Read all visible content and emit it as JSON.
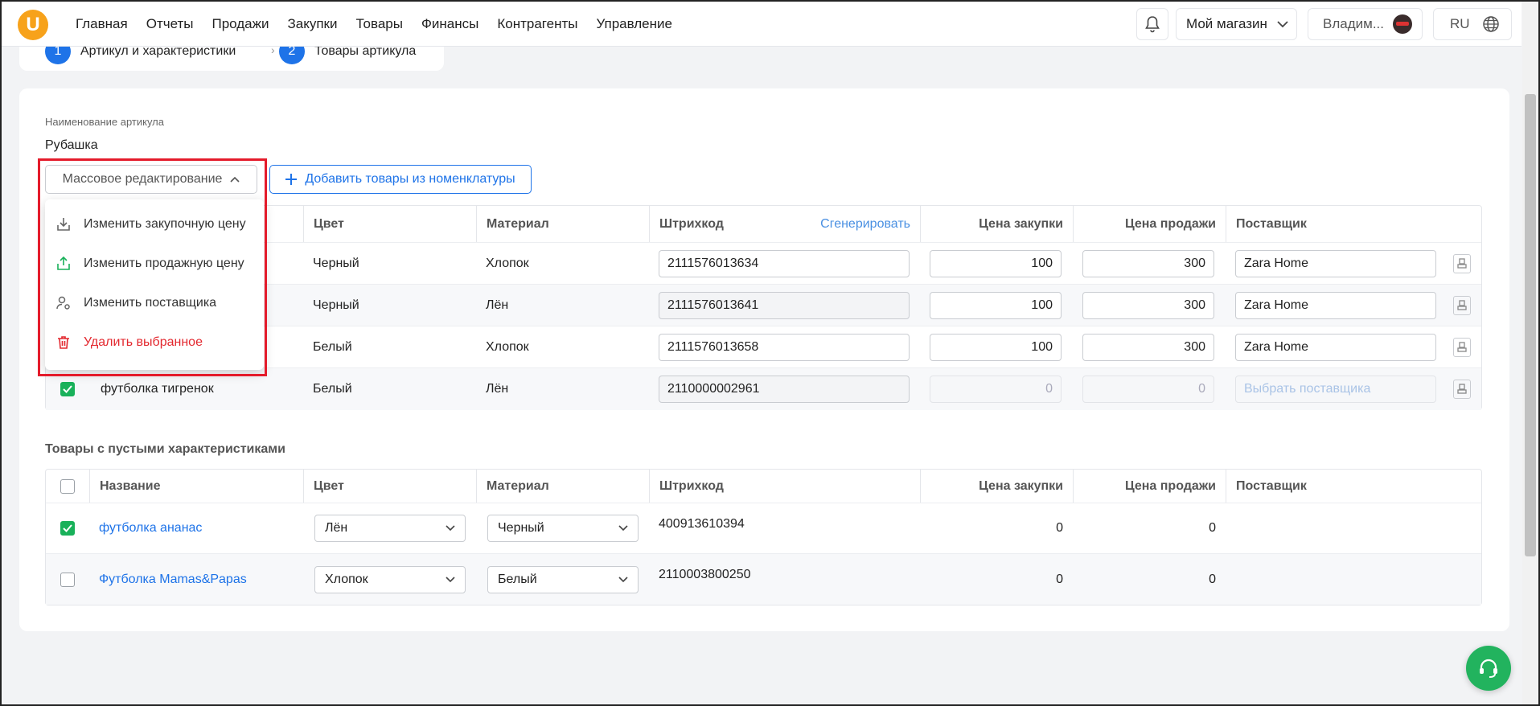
{
  "nav": [
    "Главная",
    "Отчеты",
    "Продажи",
    "Закупки",
    "Товары",
    "Финансы",
    "Контрагенты",
    "Управление"
  ],
  "header": {
    "logo": "U",
    "store": "Мой магазин",
    "user": "Владим...",
    "lang": "RU"
  },
  "stepper": {
    "step1_num": "1",
    "step1": "Артикул и характеристики",
    "step2_num": "2",
    "step2": "Товары артикула"
  },
  "article": {
    "label": "Наименование артикула",
    "name": "Рубашка"
  },
  "toolbar": {
    "mass_edit": "Массовое редактирование",
    "add_items": "Добавить товары из номенклатуры"
  },
  "dropdown": [
    "Изменить закупочную цену",
    "Изменить продажную цену",
    "Изменить поставщика",
    "Удалить выбранное"
  ],
  "table1": {
    "headers": {
      "color": "Цвет",
      "material": "Материал",
      "barcode": "Штрихкод",
      "generate": "Сгенерировать",
      "buy": "Цена закупки",
      "sell": "Цена продажи",
      "supplier": "Поставщик"
    },
    "rows": [
      {
        "name": "",
        "color": "Черный",
        "material": "Хлопок",
        "barcode": "2111576013634",
        "buy": "100",
        "sell": "300",
        "supplier": "Zara Home"
      },
      {
        "name": "",
        "color": "Черный",
        "material": "Лён",
        "barcode": "2111576013641",
        "buy": "100",
        "sell": "300",
        "supplier": "Zara Home"
      },
      {
        "name": "",
        "color": "Белый",
        "material": "Хлопок",
        "barcode": "2111576013658",
        "buy": "100",
        "sell": "300",
        "supplier": "Zara Home"
      },
      {
        "name": "футболка тигренок",
        "color": "Белый",
        "material": "Лён",
        "barcode": "2110000002961",
        "buy": "0",
        "sell": "0",
        "supplier": "Выбрать поставщика"
      }
    ]
  },
  "empty_section": {
    "title": "Товары с пустыми характеристиками",
    "headers": {
      "name": "Название",
      "color": "Цвет",
      "material": "Материал",
      "barcode": "Штрихкод",
      "buy": "Цена закупки",
      "sell": "Цена продажи",
      "supplier": "Поставщик"
    },
    "rows": [
      {
        "name": "футболка ананас",
        "color": "Лён",
        "material": "Черный",
        "barcode": "400913610394",
        "buy": "0",
        "sell": "0"
      },
      {
        "name": "Футболка Mamas&Papas",
        "color": "Хлопок",
        "material": "Белый",
        "barcode": "2110003800250",
        "buy": "0",
        "sell": "0"
      }
    ]
  }
}
